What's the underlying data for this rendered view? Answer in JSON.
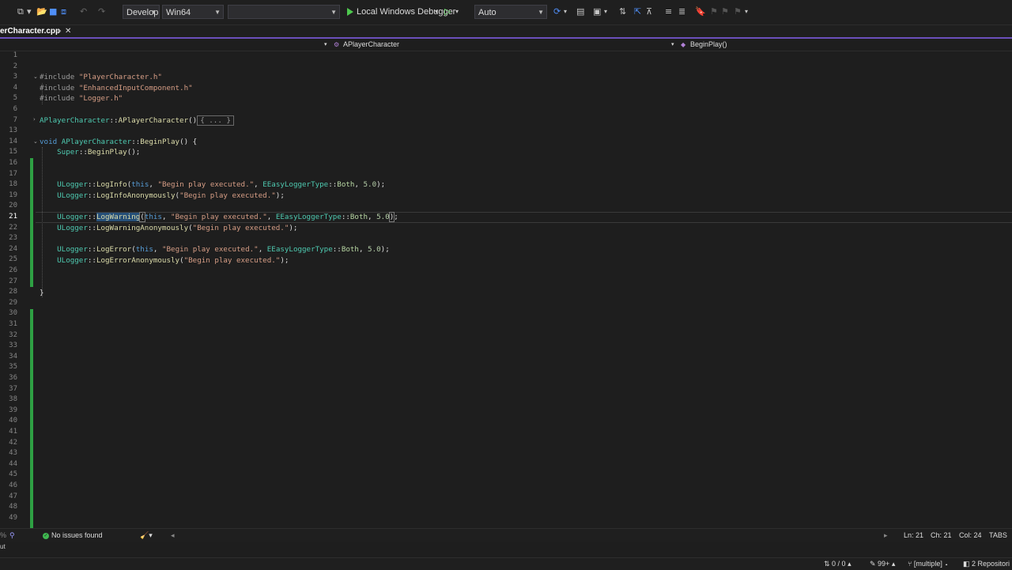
{
  "toolbar": {
    "config_dropdown": "Develop",
    "platform_dropdown": "Win64",
    "project_dropdown": "",
    "debugger_label": "Local Windows Debugger",
    "build_mode_dropdown": "Auto"
  },
  "tab": {
    "filename": "erCharacter.cpp",
    "pin": "⊸",
    "close": "✕"
  },
  "navbar": {
    "class_scope": "APlayerCharacter",
    "member_scope": "BeginPlay()"
  },
  "editor": {
    "line_numbers": [
      "1",
      "2",
      "3",
      "4",
      "5",
      "6",
      "7",
      "13",
      "14",
      "15",
      "16",
      "17",
      "18",
      "19",
      "20",
      "21",
      "22",
      "23",
      "24",
      "25",
      "26",
      "27",
      "28",
      "29",
      "30",
      "31",
      "32",
      "33",
      "34",
      "35",
      "36",
      "37",
      "38",
      "39",
      "40",
      "41",
      "42",
      "43",
      "44",
      "45",
      "46",
      "47",
      "48",
      "49"
    ],
    "current_line": "21",
    "code": {
      "l3_kw": "#include",
      "l3_str": "\"PlayerCharacter.h\"",
      "l4_kw": "#include",
      "l4_str": "\"EnhancedInputComponent.h\"",
      "l5_kw": "#include",
      "l5_str": "\"Logger.h\"",
      "l7_cls1": "APlayerCharacter",
      "l7_op": "::",
      "l7_fn": "APlayerCharacter",
      "l7_paren": "()",
      "l7_collapsed": "{ ... }",
      "l14_kw": "void",
      "l14_cls": "APlayerCharacter",
      "l14_op": "::",
      "l14_fn": "BeginPlay",
      "l14_rest": "() {",
      "l15_cls": "Super",
      "l15_op": "::",
      "l15_fn": "BeginPlay",
      "l15_rest": "();",
      "l18": {
        "cls": "ULogger",
        "op": "::",
        "fn": "LogInfo",
        "p1": "(",
        "this": "this",
        "c1": ", ",
        "str": "\"Begin play executed.\"",
        "c2": ", ",
        "enum": "EEasyLoggerType",
        "op2": "::",
        "val": "Both",
        "c3": ", ",
        "num": "5.0",
        "end": ");"
      },
      "l19": {
        "cls": "ULogger",
        "op": "::",
        "fn": "LogInfoAnonymously",
        "p1": "(",
        "str": "\"Begin play executed.\"",
        "end": ");"
      },
      "l21": {
        "cls": "ULogger",
        "op": "::",
        "fn": "LogWarning",
        "p1": "(",
        "this": "this",
        "c1": ", ",
        "str": "\"Begin play executed.\"",
        "c2": ", ",
        "enum": "EEasyLoggerType",
        "op2": "::",
        "val": "Both",
        "c3": ", ",
        "num": "5.0",
        "p2": ")",
        "end": ";"
      },
      "l22": {
        "cls": "ULogger",
        "op": "::",
        "fn": "LogWarningAnonymously",
        "p1": "(",
        "str": "\"Begin play executed.\"",
        "end": ");"
      },
      "l24": {
        "cls": "ULogger",
        "op": "::",
        "fn": "LogError",
        "p1": "(",
        "this": "this",
        "c1": ", ",
        "str": "\"Begin play executed.\"",
        "c2": ", ",
        "enum": "EEasyLoggerType",
        "op2": "::",
        "val": "Both",
        "c3": ", ",
        "num": "5.0",
        "end": ");"
      },
      "l25": {
        "cls": "ULogger",
        "op": "::",
        "fn": "LogErrorAnonymously",
        "p1": "(",
        "str": "\"Begin play executed.\"",
        "end": ");"
      },
      "l28": "}"
    }
  },
  "statusbar": {
    "issues": "No issues found",
    "line": "Ln: 21",
    "char": "Ch: 21",
    "col": "Col: 24",
    "indent": "TABS"
  },
  "bottom_panel": {
    "text": "ut"
  },
  "outer_status": {
    "errors": "0 / 0",
    "changes": "99+",
    "branch": "[multiple]",
    "repos": "2 Repositori"
  },
  "colors": {
    "accent": "#6b4fbb",
    "change_bar": "#2ea043",
    "run_green": "#4ec94e"
  }
}
